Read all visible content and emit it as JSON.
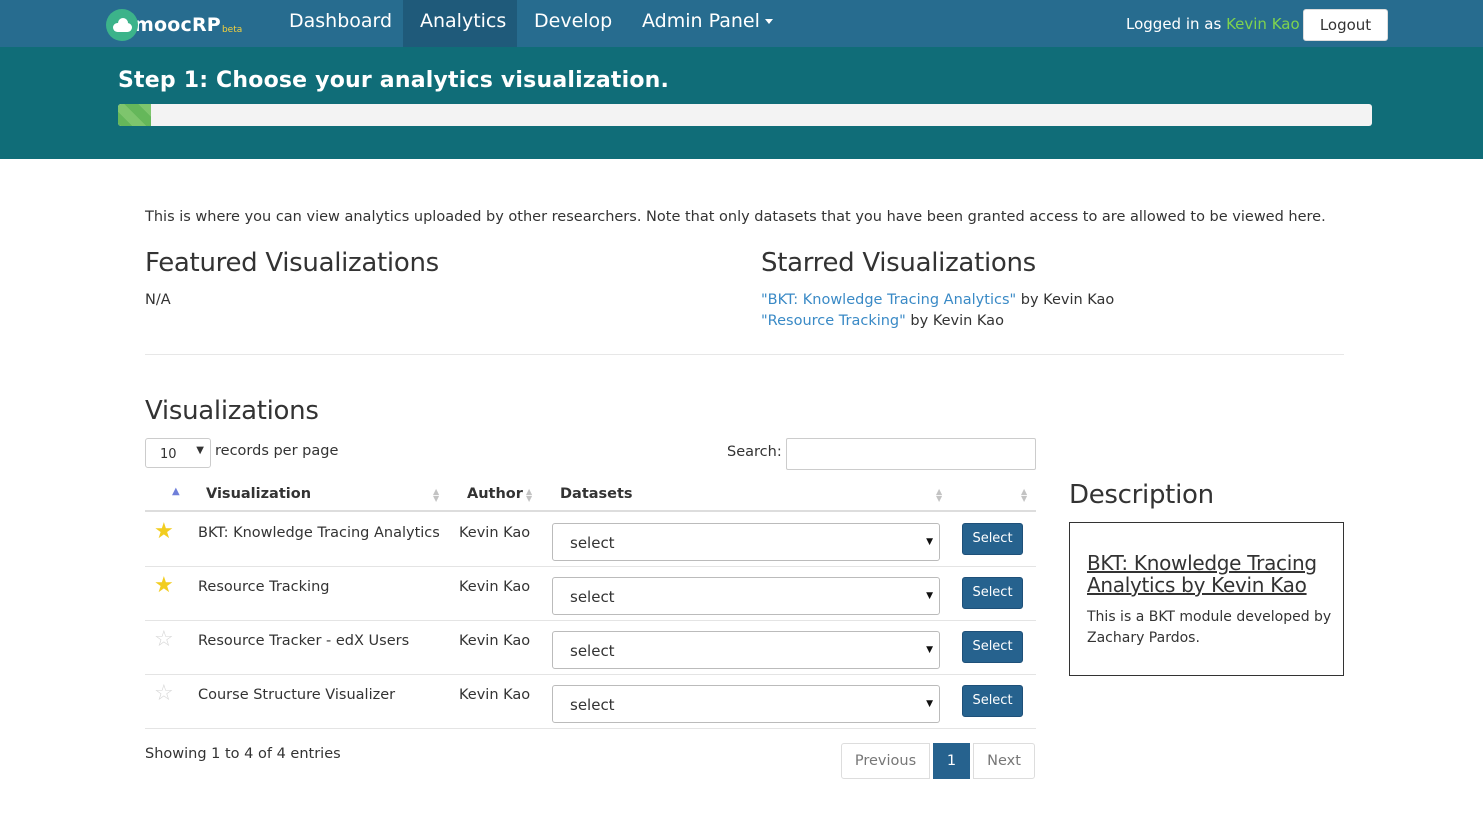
{
  "nav": {
    "brand": "moocRP",
    "brand_tag": "beta",
    "items": [
      {
        "label": "Dashboard"
      },
      {
        "label": "Analytics"
      },
      {
        "label": "Develop"
      },
      {
        "label": "Admin Panel"
      }
    ],
    "login_prefix": "Logged in as",
    "login_user": "Kevin Kao",
    "logout_label": "Logout"
  },
  "header": {
    "step_title": "Step 1: Choose your analytics visualization.",
    "progress_fraction": 0.026
  },
  "intro": "This is where you can view analytics uploaded by other researchers. Note that only datasets that you have been granted access to are allowed to be viewed here.",
  "featured": {
    "heading": "Featured Visualizations",
    "empty": "N/A"
  },
  "starred": {
    "heading": "Starred Visualizations",
    "items": [
      {
        "title": "\"BKT: Knowledge Tracing Analytics\"",
        "by": "by Kevin Kao"
      },
      {
        "title": "\"Resource Tracking\"",
        "by": "by Kevin Kao"
      }
    ]
  },
  "visualizations": {
    "heading": "Visualizations",
    "page_length": "10",
    "records_label": "records per page",
    "search_label": "Search:",
    "columns": [
      "Visualization",
      "Author",
      "Datasets"
    ],
    "rows": [
      {
        "starred": true,
        "name": "BKT: Knowledge Tracing Analytics",
        "author": "Kevin Kao",
        "dataset": "select",
        "action": "Select"
      },
      {
        "starred": true,
        "name": "Resource Tracking",
        "author": "Kevin Kao",
        "dataset": "select",
        "action": "Select"
      },
      {
        "starred": false,
        "name": "Resource Tracker - edX Users",
        "author": "Kevin Kao",
        "dataset": "select",
        "action": "Select"
      },
      {
        "starred": false,
        "name": "Course Structure Visualizer",
        "author": "Kevin Kao",
        "dataset": "select",
        "action": "Select"
      }
    ],
    "info": "Showing 1 to 4 of 4 entries",
    "pagination": {
      "previous": "Previous",
      "current": "1",
      "next": "Next"
    }
  },
  "description": {
    "heading": "Description",
    "title": "BKT: Knowledge Tracing Analytics by Kevin Kao",
    "body": "This is a BKT module developed by Zachary Pardos."
  },
  "colors": {
    "navbar": "#276c8f",
    "header_band": "#106d78",
    "accent_button": "#26628e",
    "link": "#3a8ac6",
    "user_name": "#7fd34e",
    "star_on": "#f2cd1f"
  }
}
